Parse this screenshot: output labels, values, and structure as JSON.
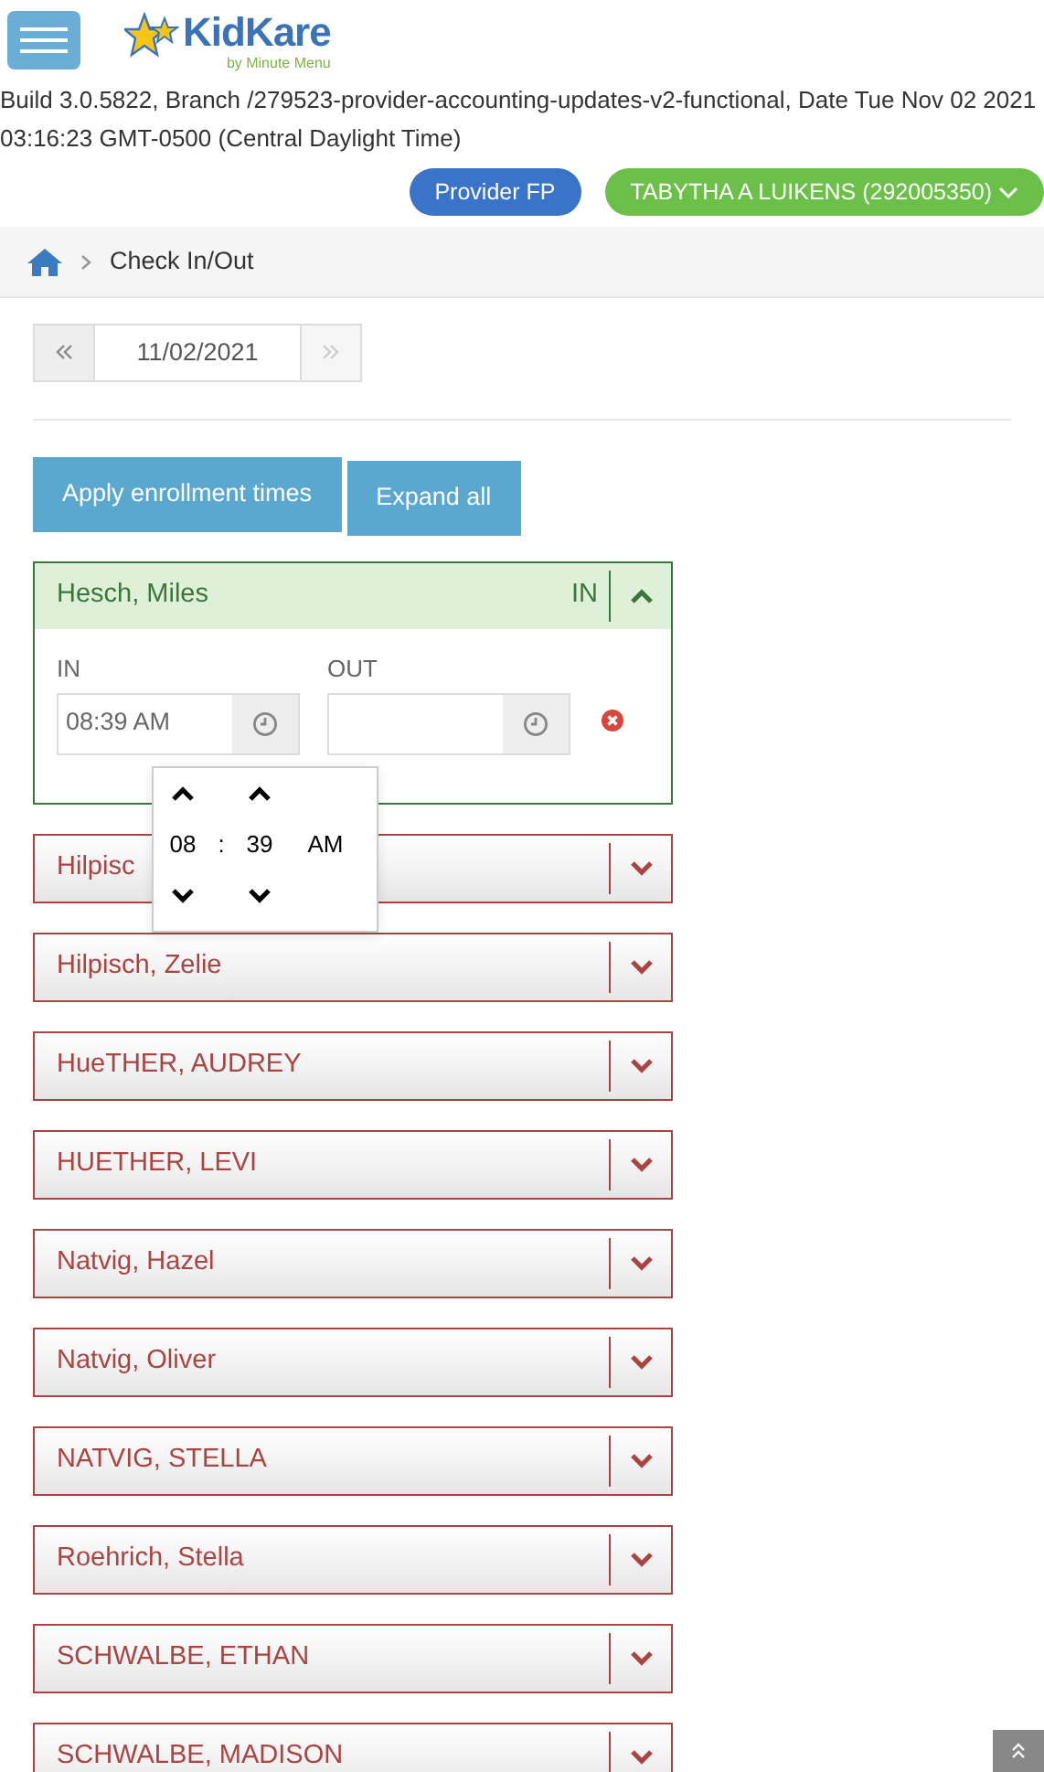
{
  "header": {
    "logo": {
      "name": "KidKare",
      "tagline": "by Minute Menu"
    }
  },
  "build_info": "Build 3.0.5822, Branch /279523-provider-accounting-updates-v2-functional, Date Tue Nov 02 2021 03:16:23 GMT-0500 (Central Daylight Time)",
  "badges": [
    {
      "label": "Provider FP",
      "kind": "provider"
    },
    {
      "label": "TABYTHA A LUIKENS (292005350)",
      "kind": "user"
    }
  ],
  "breadcrumb": {
    "items": [
      "Check In/Out"
    ]
  },
  "date_pager": {
    "date": "11/02/2021",
    "next_disabled": true
  },
  "actions": [
    "Apply enrollment times",
    "Expand all"
  ],
  "children": [
    {
      "name": "Hesch, Miles",
      "checked_in": true,
      "status": "IN",
      "expanded": true,
      "in_label": "IN",
      "in_value": "08:39 AM",
      "out_label": "OUT"
    },
    {
      "name": "Hilpisc",
      "checked_in": false,
      "expanded": false
    },
    {
      "name": "Hilpisch, Zelie",
      "checked_in": false,
      "expanded": false
    },
    {
      "name": "HueTHER, AUDREY",
      "checked_in": false,
      "expanded": false
    },
    {
      "name": "HUETHER, LEVI",
      "checked_in": false,
      "expanded": false
    },
    {
      "name": "Natvig, Hazel",
      "checked_in": false,
      "expanded": false
    },
    {
      "name": "Natvig, Oliver",
      "checked_in": false,
      "expanded": false
    },
    {
      "name": "NATVIG, STELLA",
      "checked_in": false,
      "expanded": false
    },
    {
      "name": "Roehrich, Stella",
      "checked_in": false,
      "expanded": false
    },
    {
      "name": "SCHWALBE, ETHAN",
      "checked_in": false,
      "expanded": false
    },
    {
      "name": "SCHWALBE, MADISON",
      "checked_in": false,
      "expanded": false
    }
  ],
  "time_picker": {
    "hour": "08",
    "separator": ":",
    "minute": "39",
    "period": "AM"
  }
}
